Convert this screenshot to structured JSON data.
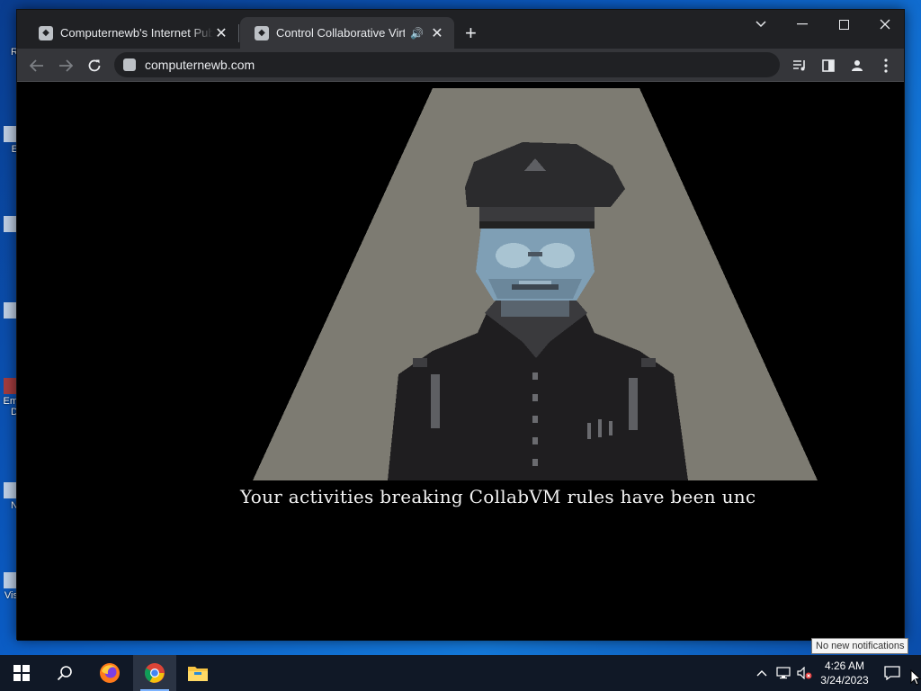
{
  "desktop": {
    "icon_fragments": [
      "R",
      "E",
      "",
      "",
      "Em\nD",
      "N",
      "Vis"
    ]
  },
  "browser": {
    "tabs": [
      {
        "title": "Computernewb's Internet Pub Hub",
        "active": false,
        "favicon": "computernewb-favicon"
      },
      {
        "title": "Control Collaborative Virtual Machines!",
        "active": true,
        "favicon": "computernewb-favicon",
        "audio": "speaker-icon"
      }
    ],
    "close_glyph": "✕",
    "new_tab_glyph": "+",
    "address": "computernewb.com",
    "window_controls": {
      "tab_search": "⌄",
      "minimize": "—",
      "maximize": "□",
      "close": "✕"
    },
    "nav": {
      "back": "←",
      "forward": "→",
      "reload": "↻"
    },
    "toolbar_icons": [
      "media-control-icon",
      "side-panel-icon",
      "profile-icon",
      "menu-icon"
    ]
  },
  "page": {
    "caption": "Your activities breaking CollabVM rules have been unc",
    "colors": {
      "spotlight": "#7d7b72",
      "background": "#000000",
      "skin": "#7f9fb5",
      "uniform": "#2b2b2d"
    }
  },
  "notification": {
    "text": "No new notifications"
  },
  "taskbar": {
    "apps": [
      "windows-start-icon",
      "search-icon",
      "firefox-icon",
      "chrome-icon",
      "file-explorer-icon"
    ],
    "time": "4:26 AM",
    "date": "3/24/2023"
  }
}
